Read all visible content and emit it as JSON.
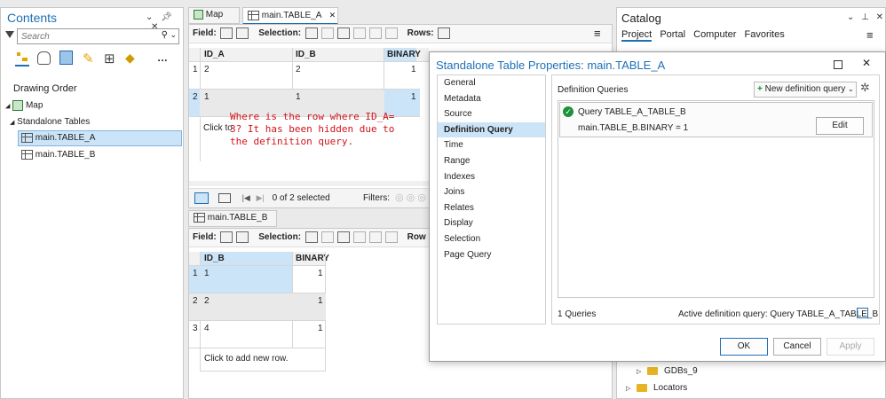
{
  "contents": {
    "title": "Contents",
    "search_placeholder": "Search",
    "drawing_order": "Drawing Order",
    "tree": [
      "Map",
      "Standalone Tables",
      "main.TABLE_A",
      "main.TABLE_B"
    ]
  },
  "tabs": {
    "map": "Map",
    "table_a": "main.TABLE_A",
    "table_b": "main.TABLE_B"
  },
  "toolbar": {
    "field": "Field:",
    "selection": "Selection:",
    "rows": "Rows:"
  },
  "table_a": {
    "headers": [
      "ID_A",
      "ID_B",
      "BINARY"
    ],
    "rows": [
      {
        "num": "1",
        "id_a": "2",
        "id_b": "2",
        "binary": "1"
      },
      {
        "num": "2",
        "id_a": "1",
        "id_b": "1",
        "binary": "1"
      }
    ],
    "add_row": "Click to",
    "status": "0 of 2 selected",
    "filters": "Filters:"
  },
  "annotation": "Where is the row where ID_A=\n3? It has been hidden due to\nthe definition query.",
  "table_b": {
    "headers": [
      "ID_B",
      "BINARY"
    ],
    "rows": [
      {
        "num": "1",
        "id_b": "1",
        "binary": "1"
      },
      {
        "num": "2",
        "id_b": "2",
        "binary": "1"
      },
      {
        "num": "3",
        "id_b": "4",
        "binary": "1"
      }
    ],
    "add_row": "Click to add new row."
  },
  "catalog": {
    "title": "Catalog",
    "tabs": [
      "Project",
      "Portal",
      "Computer",
      "Favorites"
    ],
    "items": [
      "GDBs_9",
      "Locators"
    ]
  },
  "dialog": {
    "title": "Standalone Table Properties: main.TABLE_A",
    "nav": [
      "General",
      "Metadata",
      "Source",
      "Definition Query",
      "Time",
      "Range",
      "Indexes",
      "Joins",
      "Relates",
      "Display",
      "Selection",
      "Page Query"
    ],
    "section": "Definition Queries",
    "new_query": "New definition query",
    "query_name": "Query TABLE_A_TABLE_B",
    "query_expr": "main.TABLE_B.BINARY = 1",
    "edit": "Edit",
    "count": "1 Queries",
    "active": "Active definition query: Query TABLE_A_TABLE_B",
    "ok": "OK",
    "cancel": "Cancel",
    "apply": "Apply"
  },
  "colors": {
    "accent": "#1f6fb5",
    "selected": "#cce4f7",
    "annotation": "#d0141b",
    "check": "#1e8f3a"
  }
}
